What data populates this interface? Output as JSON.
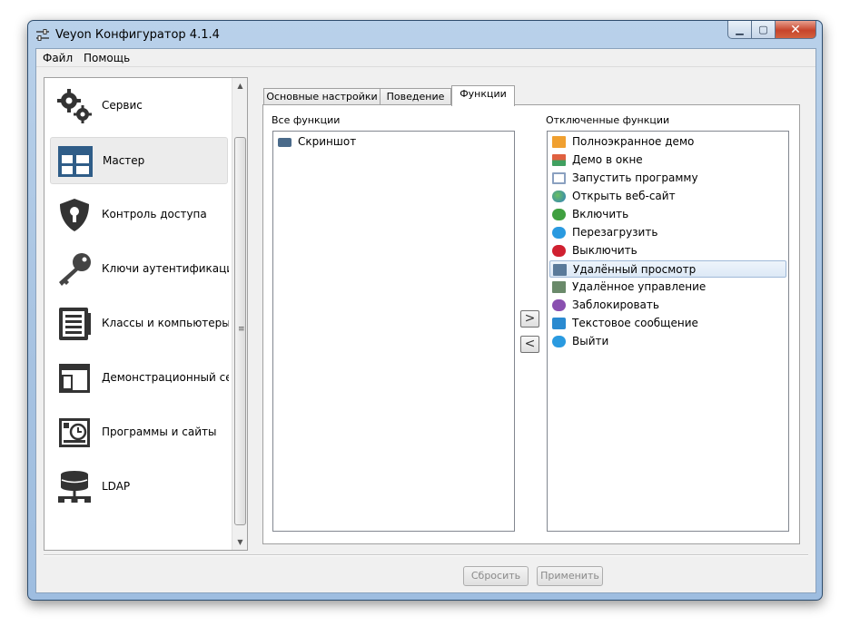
{
  "window": {
    "title": "Veyon Конфигуратор 4.1.4"
  },
  "menu": [
    "Файл",
    "Помощь"
  ],
  "nav": {
    "items": [
      {
        "label": "Сервис",
        "icon": "gears-icon"
      },
      {
        "label": "Мастер",
        "icon": "master-grid-icon",
        "selected": true
      },
      {
        "label": "Контроль доступа",
        "icon": "shield-keyhole-icon"
      },
      {
        "label": "Ключи аутентификации",
        "icon": "key-icon"
      },
      {
        "label": "Классы и компьютеры",
        "icon": "list-document-icon"
      },
      {
        "label": "Демонстрационный серв",
        "icon": "demo-window-icon"
      },
      {
        "label": "Программы и сайты",
        "icon": "programs-clock-icon"
      },
      {
        "label": "LDAP",
        "icon": "database-network-icon"
      }
    ]
  },
  "tabs": [
    {
      "label": "Основные настройки"
    },
    {
      "label": "Поведение"
    },
    {
      "label": "Функции",
      "active": true
    }
  ],
  "all_features": {
    "caption": "Все функции",
    "items": [
      {
        "label": "Скриншот",
        "icon": "camera-icon",
        "color": "#4a6a8a"
      }
    ]
  },
  "disabled_features": {
    "caption": "Отключенные функции",
    "items": [
      {
        "label": "Полноэкранное демо",
        "icon": "fullscreen-demo-icon",
        "color": "#f0a030"
      },
      {
        "label": "Демо в окне",
        "icon": "window-demo-icon",
        "color": "#e06040"
      },
      {
        "label": "Запустить программу",
        "icon": "run-program-icon",
        "color": "#8aa0c0"
      },
      {
        "label": "Открыть веб-сайт",
        "icon": "globe-icon",
        "color": "#3080c0"
      },
      {
        "label": "Включить",
        "icon": "power-on-icon",
        "color": "#40a040"
      },
      {
        "label": "Перезагрузить",
        "icon": "reboot-icon",
        "color": "#2a9ae0"
      },
      {
        "label": "Выключить",
        "icon": "power-off-icon",
        "color": "#d02030"
      },
      {
        "label": "Удалённый просмотр",
        "icon": "remote-view-icon",
        "color": "#5a7a9a",
        "selected": true
      },
      {
        "label": "Удалённое управление",
        "icon": "remote-control-icon",
        "color": "#6a8a6a"
      },
      {
        "label": "Заблокировать",
        "icon": "lock-icon",
        "color": "#8a50b0"
      },
      {
        "label": "Текстовое сообщение",
        "icon": "message-icon",
        "color": "#2a8ad0"
      },
      {
        "label": "Выйти",
        "icon": "logout-icon",
        "color": "#2a9ae0"
      }
    ]
  },
  "buttons": {
    "move_right": ">",
    "move_left": "<",
    "reset": "Сбросить",
    "apply": "Применить"
  }
}
